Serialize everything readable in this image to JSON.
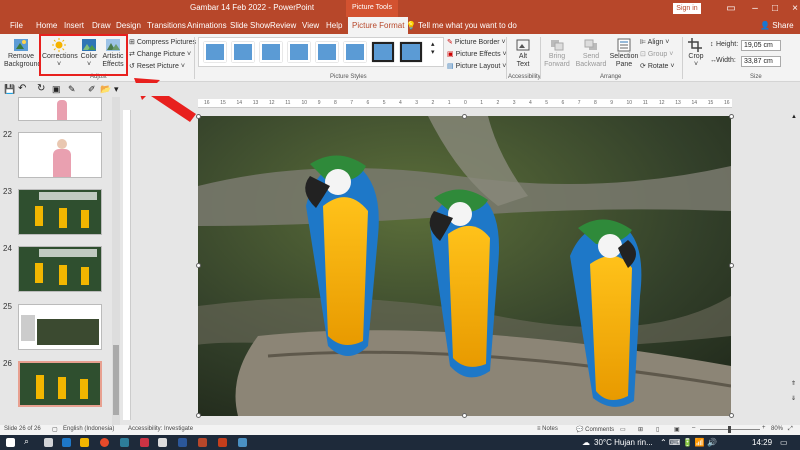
{
  "titlebar": {
    "document": "Gambar 14 Feb 2022",
    "separator": "-",
    "app": "PowerPoint",
    "context_tab_group": "Picture Tools",
    "signin": "Sign in"
  },
  "tabs": [
    "File",
    "Home",
    "Insert",
    "Draw",
    "Design",
    "Transitions",
    "Animations",
    "Slide Show",
    "Review",
    "View",
    "Help",
    "Picture Format"
  ],
  "active_tab": "Picture Format",
  "tell_me": "Tell me what you want to do",
  "share": "Share",
  "ribbon": {
    "remove_background": [
      "Remove",
      "Background"
    ],
    "corrections": "Corrections",
    "color": "Color",
    "artistic_effects": [
      "Artistic",
      "Effects"
    ],
    "compress": "Compress Pictures",
    "change": "Change Picture",
    "reset": "Reset Picture",
    "adjust_label": "Adjust",
    "picture_styles_label": "Picture Styles",
    "picture_border": "Picture Border",
    "picture_effects": "Picture Effects",
    "picture_layout": "Picture Layout",
    "alt_text": [
      "Alt",
      "Text"
    ],
    "accessibility_label": "Accessibility",
    "bring_forward": [
      "Bring",
      "Forward"
    ],
    "send_backward": [
      "Send",
      "Backward"
    ],
    "selection_pane": [
      "Selection",
      "Pane"
    ],
    "align": "Align",
    "group": "Group",
    "rotate": "Rotate",
    "arrange_label": "Arrange",
    "crop": "Crop",
    "height_label": "Height:",
    "height_value": "19,05 cm",
    "width_label": "Width:",
    "width_value": "33,87 cm",
    "size_label": "Size"
  },
  "ruler_ticks": [
    "16",
    "15",
    "14",
    "13",
    "12",
    "11",
    "10",
    "9",
    "8",
    "7",
    "6",
    "5",
    "4",
    "3",
    "2",
    "1",
    "0",
    "1",
    "2",
    "3",
    "4",
    "5",
    "6",
    "7",
    "8",
    "9",
    "10",
    "11",
    "12",
    "13",
    "14",
    "15",
    "16"
  ],
  "slides": [
    {
      "num": "22"
    },
    {
      "num": "23"
    },
    {
      "num": "24"
    },
    {
      "num": "25"
    },
    {
      "num": "26"
    }
  ],
  "status": {
    "slide": "Slide 26 of 26",
    "language": "English (Indonesia)",
    "accessibility": "Accessibility: Investigate",
    "notes": "Notes",
    "comments": "Comments",
    "zoom": "80%"
  },
  "taskbar": {
    "weather": "30°C  Hujan rin...",
    "time": "14:29"
  },
  "colors": {
    "accent": "#b7472a",
    "highlight": "#e8201e",
    "arrow": "#e8201e"
  }
}
